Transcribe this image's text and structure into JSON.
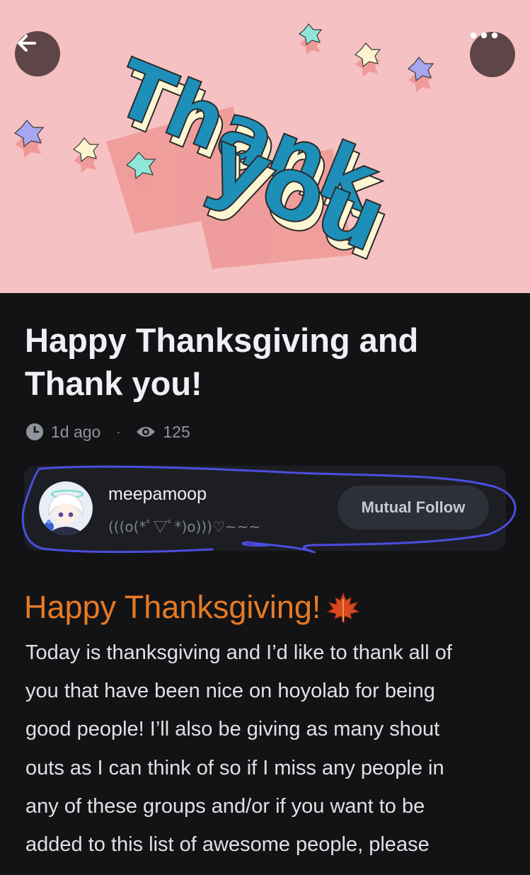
{
  "hero": {
    "banner_text_line1": "Thank",
    "banner_text_line2": "you",
    "colors": {
      "background": "#f6c1c2",
      "letters": "#1d8fb8",
      "extrude": "#fcf6d2"
    }
  },
  "nav": {
    "back_icon": "arrow-left-icon",
    "more_icon": "ellipsis-icon"
  },
  "post": {
    "title": "Happy Thanksgiving and Thank you!",
    "time": "1d ago",
    "separator": "·",
    "views": "125"
  },
  "author": {
    "username": "meepamoop",
    "bio": "(((o(*ﾟ▽ﾟ*)o)))♡~~~",
    "follow_label": "Mutual Follow"
  },
  "content": {
    "heading": "Happy Thanksgiving!",
    "heading_icon": "maple-leaf-icon",
    "heading_color": "#e77a24",
    "lines": [
      "Today is thanksgiving and I’d like to thank all of",
      "you that have been nice on hoyolab for being",
      "good people! I’ll also be giving as many shout",
      "outs as I can think of so if I miss any people in",
      "any of these groups and/or if you want to be",
      "added to this list of awesome people, please"
    ]
  },
  "annotation": {
    "color": "#4b4de0"
  }
}
